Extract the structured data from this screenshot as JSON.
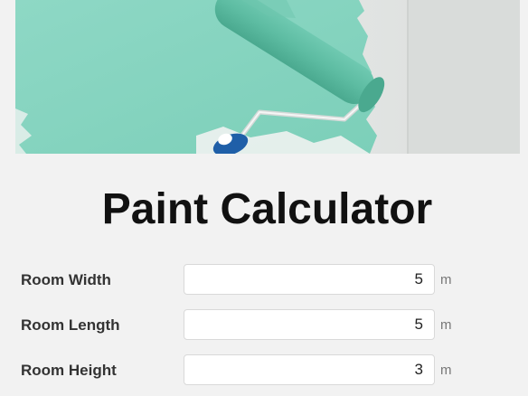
{
  "page": {
    "title": "Paint Calculator"
  },
  "fields": [
    {
      "label": "Room Width",
      "value": "5",
      "unit": "m"
    },
    {
      "label": "Room Length",
      "value": "5",
      "unit": "m"
    },
    {
      "label": "Room Height",
      "value": "3",
      "unit": "m"
    }
  ],
  "hero": {
    "description_icon": "paint-roller-image",
    "paint_color": "#7fd3bd"
  }
}
